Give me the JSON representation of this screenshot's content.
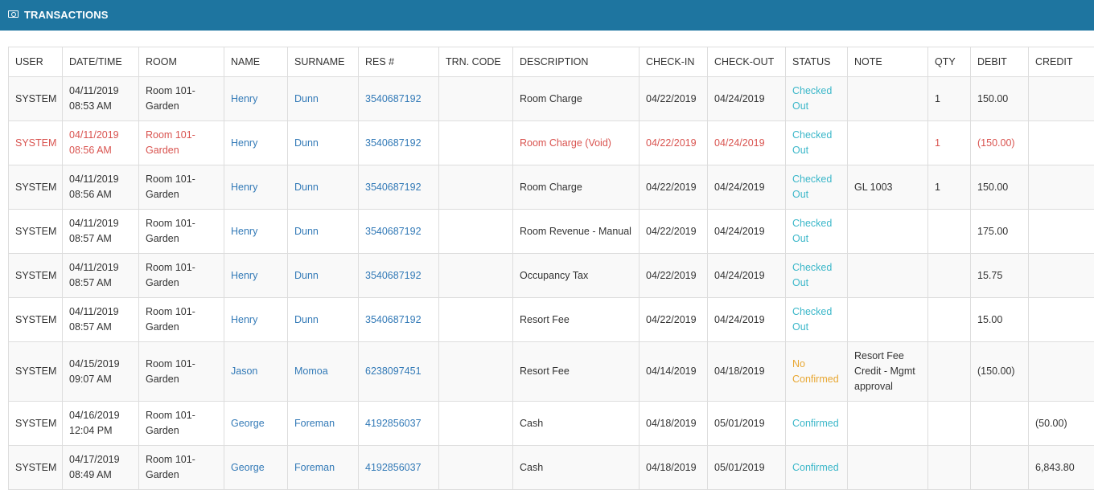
{
  "header": {
    "title": "TRANSACTIONS",
    "icon": "money-icon"
  },
  "table": {
    "columns": [
      "USER",
      "DATE/TIME",
      "ROOM",
      "NAME",
      "SURNAME",
      "RES #",
      "TRN. CODE",
      "DESCRIPTION",
      "CHECK-IN",
      "CHECK-OUT",
      "STATUS",
      "NOTE",
      "QTY",
      "DEBIT",
      "CREDIT"
    ],
    "rows": [
      {
        "user": "SYSTEM",
        "date": "04/11/2019",
        "time": "08:53 AM",
        "room1": "Room 101-",
        "room2": "Garden",
        "name": "Henry",
        "surname": "Dunn",
        "res": "3540687192",
        "trn": "",
        "description": "Room Charge",
        "checkin": "04/22/2019",
        "checkout": "04/24/2019",
        "status1": "Checked",
        "status2": "Out",
        "note": "",
        "qty": "1",
        "debit": "150.00",
        "credit": ""
      },
      {
        "user": "SYSTEM",
        "date": "04/11/2019",
        "time": "08:56 AM",
        "room1": "Room 101-",
        "room2": "Garden",
        "name": "Henry",
        "surname": "Dunn",
        "res": "3540687192",
        "trn": "",
        "description": "Room Charge (Void)",
        "checkin": "04/22/2019",
        "checkout": "04/24/2019",
        "status1": "Checked",
        "status2": "Out",
        "note": "",
        "qty": "1",
        "debit": "(150.00)",
        "credit": ""
      },
      {
        "user": "SYSTEM",
        "date": "04/11/2019",
        "time": "08:56 AM",
        "room1": "Room 101-",
        "room2": "Garden",
        "name": "Henry",
        "surname": "Dunn",
        "res": "3540687192",
        "trn": "",
        "description": "Room Charge",
        "checkin": "04/22/2019",
        "checkout": "04/24/2019",
        "status1": "Checked",
        "status2": "Out",
        "note": "GL 1003",
        "qty": "1",
        "debit": "150.00",
        "credit": ""
      },
      {
        "user": "SYSTEM",
        "date": "04/11/2019",
        "time": "08:57 AM",
        "room1": "Room 101-",
        "room2": "Garden",
        "name": "Henry",
        "surname": "Dunn",
        "res": "3540687192",
        "trn": "",
        "description": "Room Revenue - Manual",
        "checkin": "04/22/2019",
        "checkout": "04/24/2019",
        "status1": "Checked",
        "status2": "Out",
        "note": "",
        "qty": "",
        "debit": "175.00",
        "credit": ""
      },
      {
        "user": "SYSTEM",
        "date": "04/11/2019",
        "time": "08:57 AM",
        "room1": "Room 101-",
        "room2": "Garden",
        "name": "Henry",
        "surname": "Dunn",
        "res": "3540687192",
        "trn": "",
        "description": "Occupancy Tax",
        "checkin": "04/22/2019",
        "checkout": "04/24/2019",
        "status1": "Checked",
        "status2": "Out",
        "note": "",
        "qty": "",
        "debit": "15.75",
        "credit": ""
      },
      {
        "user": "SYSTEM",
        "date": "04/11/2019",
        "time": "08:57 AM",
        "room1": "Room 101-",
        "room2": "Garden",
        "name": "Henry",
        "surname": "Dunn",
        "res": "3540687192",
        "trn": "",
        "description": "Resort Fee",
        "checkin": "04/22/2019",
        "checkout": "04/24/2019",
        "status1": "Checked",
        "status2": "Out",
        "note": "",
        "qty": "",
        "debit": "15.00",
        "credit": ""
      },
      {
        "user": "SYSTEM",
        "date": "04/15/2019",
        "time": "09:07 AM",
        "room1": "Room 101-",
        "room2": "Garden",
        "name": "Jason",
        "surname": "Momoa",
        "res": "6238097451",
        "trn": "",
        "description": "Resort Fee",
        "checkin": "04/14/2019",
        "checkout": "04/18/2019",
        "status1": "No",
        "status2": "Confirmed",
        "note1": "Resort Fee",
        "note2": "Credit - Mgmt",
        "note3": "approval",
        "qty": "",
        "debit": "(150.00)",
        "credit": ""
      },
      {
        "user": "SYSTEM",
        "date": "04/16/2019",
        "time": "12:04 PM",
        "room1": "Room 101-",
        "room2": "Garden",
        "name": "George",
        "surname": "Foreman",
        "res": "4192856037",
        "trn": "",
        "description": "Cash",
        "checkin": "04/18/2019",
        "checkout": "05/01/2019",
        "status1": "Confirmed",
        "status2": "",
        "note": "",
        "qty": "",
        "debit": "",
        "credit": "(50.00)"
      },
      {
        "user": "SYSTEM",
        "date": "04/17/2019",
        "time": "08:49 AM",
        "room1": "Room 101-",
        "room2": "Garden",
        "name": "George",
        "surname": "Foreman",
        "res": "4192856037",
        "trn": "",
        "description": "Cash",
        "checkin": "04/18/2019",
        "checkout": "05/01/2019",
        "status1": "Confirmed",
        "status2": "",
        "note": "",
        "qty": "",
        "debit": "",
        "credit": "6,843.80"
      }
    ]
  }
}
